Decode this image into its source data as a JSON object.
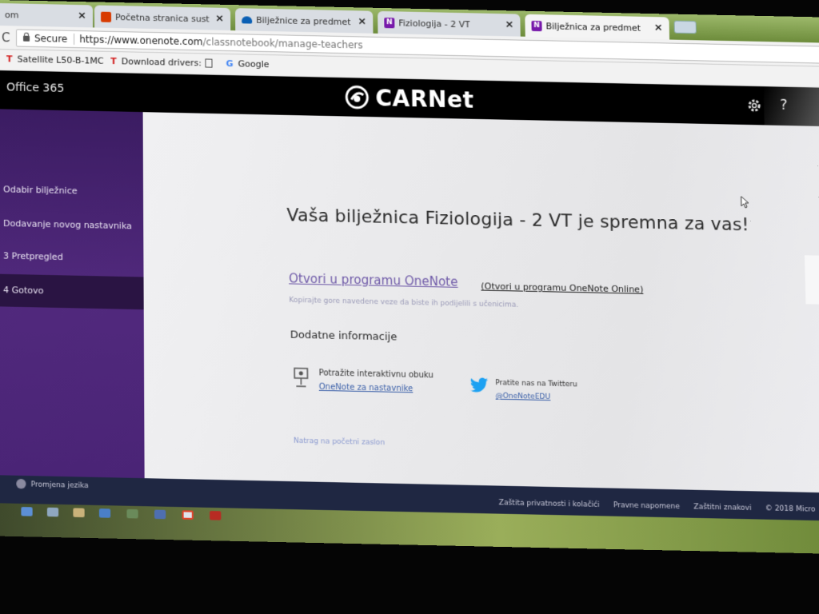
{
  "browser": {
    "tabs": [
      {
        "title": "om",
        "icon": "page-icon",
        "active": false
      },
      {
        "title": "Početna stranica sustava",
        "icon": "office-icon",
        "active": false
      },
      {
        "title": "Bilježnice za predmete -",
        "icon": "onedrive-icon",
        "active": false
      },
      {
        "title": "Fiziologija - 2 VT",
        "icon": "onenote-icon",
        "active": false
      },
      {
        "title": "Bilježnica za predmete u",
        "icon": "onenote-icon",
        "active": true
      }
    ],
    "close_glyph": "×",
    "secure_label": "Secure",
    "url_host": "https://www.onenote.com",
    "url_path": "/classnotebook/manage-teachers",
    "bookmarks": [
      {
        "label": "Satellite L50-B-1MC",
        "icon": "T"
      },
      {
        "label": "Download drivers:",
        "icon": "T"
      },
      {
        "label": "",
        "icon": "page-icon"
      },
      {
        "label": "Google",
        "icon": "G"
      }
    ]
  },
  "o365": {
    "label": "Office 365",
    "brand": "CARNet",
    "help": "?"
  },
  "sidebar": {
    "steps": [
      {
        "label": "Odabir bilježnice",
        "current": false
      },
      {
        "label": "Dodavanje novog nastavnika",
        "current": false
      },
      {
        "label": "3  Pretpregled",
        "current": false
      },
      {
        "label": "4  Gotovo",
        "current": true
      }
    ]
  },
  "main": {
    "headline": "Vaša bilježnica Fiziologija - 2 VT je spremna za vas!",
    "open_onenote": "Otvori u programu OneNote",
    "open_online": "(Otvori u programu OneNote Online)",
    "copy_note": "Kopirajte gore navedene veze da biste ih podijelili s učenicima.",
    "more_info_heading": "Dodatne informacije",
    "training_text": "Potražite interaktivnu obuku",
    "training_link": "OneNote za nastavnike",
    "twitter_text": "Pratite nas na Twitteru",
    "twitter_link": "@OneNoteEDU",
    "back_link": "Natrag na početni zaslon"
  },
  "footer": {
    "language": "Promjena jezika",
    "links": [
      "Zaštita privatnosti i kolačići",
      "Pravne napomene",
      "Zaštitni znakovi",
      "© 2018 Micro"
    ]
  },
  "colors": {
    "sidebar": "#4c2475",
    "header": "#000000",
    "link": "#6f5aa8",
    "footer": "#1f2742"
  }
}
